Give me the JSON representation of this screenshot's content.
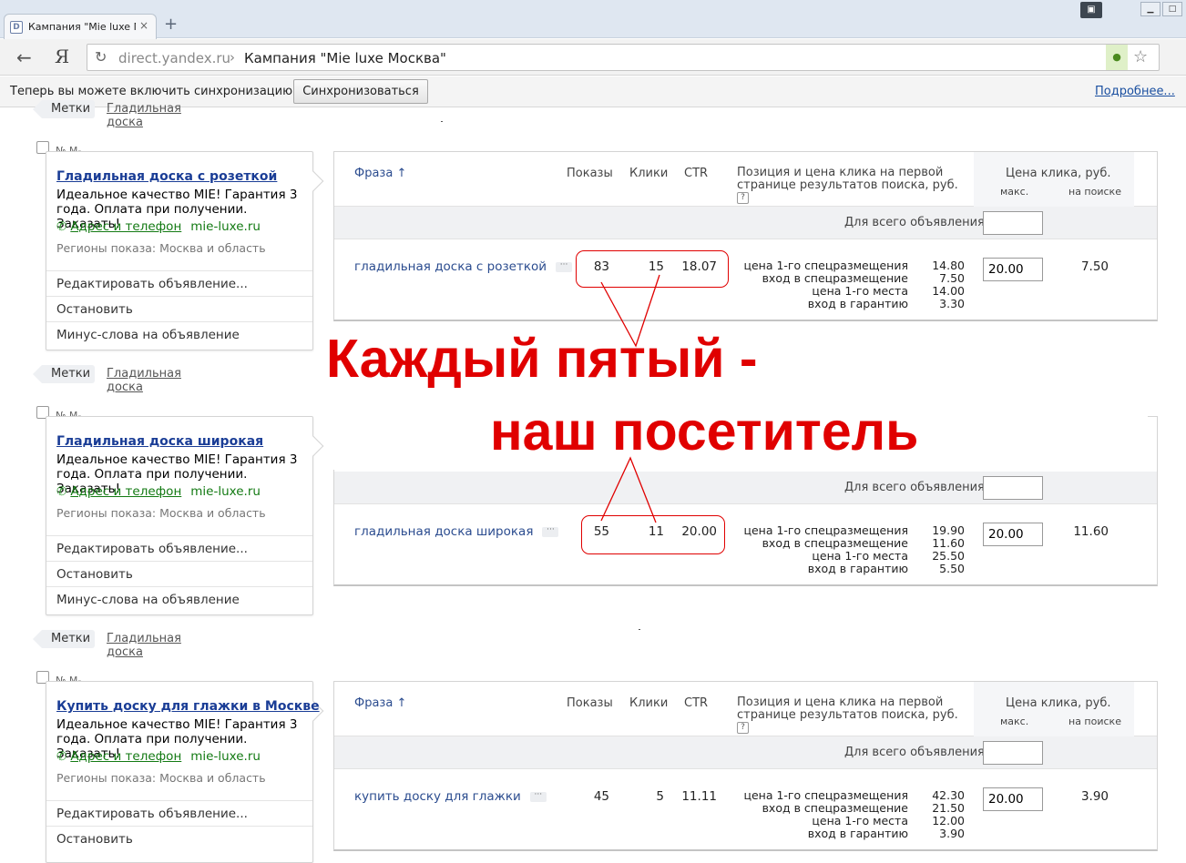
{
  "browser": {
    "tab_title": "Кампания \"Mie luxe Моск",
    "tab_close": "×",
    "new_tab": "+",
    "yandex_logo": "Я",
    "address_host": "direct.yandex.ru",
    "address_sep": "›",
    "address_page": "Кампания \"Mie luxe Москва\"",
    "icons": [
      "back-icon",
      "reload-icon",
      "lock-icon",
      "star-icon",
      "close-icon",
      "plus-icon",
      "user-icon",
      "minimize-icon",
      "maximize-icon"
    ]
  },
  "syncbar": {
    "message": "Теперь вы можете включить синхронизацию",
    "button": "Синхронизоваться",
    "more_link": "Подробнее..."
  },
  "labels": {
    "tags": "Метки",
    "tag_name": "Гладильная доска",
    "regions": "Регионы показа: Москва и область",
    "edit_ad": "Редактировать объявление...",
    "stop": "Остановить",
    "minus_words": "Минус-слова на объявление",
    "address_phone": "Адрес и телефон",
    "domain": "mie-luxe.ru",
    "ad_body": "Идеальное качество MIE! Гарантия 3 года. Оплата при получении. Заказать!",
    "ad_num_prefix": "№ М-"
  },
  "table_header": {
    "phrase": "Фраза",
    "sort_arrow": "↑",
    "impressions": "Показы",
    "clicks": "Клики",
    "ctr": "CTR",
    "position": "Позиция и цена клика на первой странице результатов поиска, руб.",
    "help": "?",
    "cpc": "Цена клика, руб.",
    "max": "макс.",
    "on_search": "на поиске",
    "whole_ad": "Для всего объявления:"
  },
  "position_labels": [
    "цена 1-го спецразмещения",
    "вход в спецразмещение",
    "цена 1-го места",
    "вход в гарантию"
  ],
  "ads": [
    {
      "title": "Гладильная доска с розеткой",
      "phrase": "гладильная доска с розеткой",
      "impressions": "83",
      "clicks": "15",
      "ctr": "18.07",
      "pos_values": [
        "14.80",
        "7.50",
        "14.00",
        "3.30"
      ],
      "max_bid": "20.00",
      "on_search": "7.50"
    },
    {
      "title": "Гладильная доска широкая",
      "phrase": "гладильная доска широкая",
      "impressions": "55",
      "clicks": "11",
      "ctr": "20.00",
      "pos_values": [
        "19.90",
        "11.60",
        "25.50",
        "5.50"
      ],
      "max_bid": "20.00",
      "on_search": "11.60"
    },
    {
      "title": "Купить доску для глажки в Москве",
      "phrase": "купить доску для глажки",
      "impressions": "45",
      "clicks": "5",
      "ctr": "11.11",
      "pos_values": [
        "42.30",
        "21.50",
        "12.00",
        "3.90"
      ],
      "max_bid": "20.00",
      "on_search": "3.90"
    }
  ],
  "overlay": {
    "line1": "Каждый пятый -",
    "line2": "наш посетитель",
    "color": "#e00000"
  },
  "colors": {
    "link_blue": "#1a3d96",
    "domain_green": "#137a13",
    "accent_red": "#e00000"
  }
}
